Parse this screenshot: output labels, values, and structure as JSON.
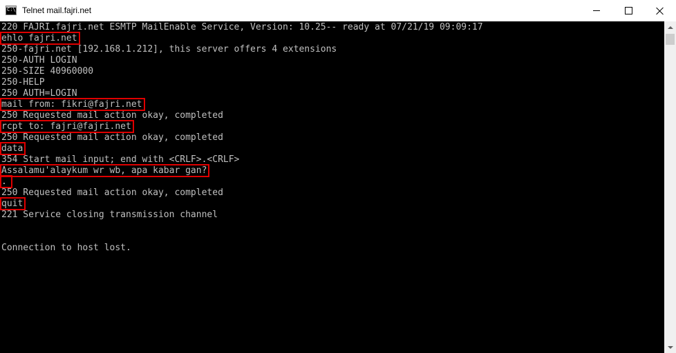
{
  "window": {
    "title": "Telnet mail.fajri.net",
    "icon": "cmd-icon",
    "icon_text": "C:\\_"
  },
  "colors": {
    "console_bg": "#000000",
    "console_text": "#c0c0c0",
    "highlight_box": "#e00000"
  },
  "console": {
    "lines": [
      "220 FAJRI.fajri.net ESMTP MailEnable Service, Version: 10.25-- ready at 07/21/19 09:09:17",
      "ehlo fajri.net",
      "250-fajri.net [192.168.1.212], this server offers 4 extensions",
      "250-AUTH LOGIN",
      "250-SIZE 40960000",
      "250-HELP",
      "250 AUTH=LOGIN",
      "mail from: fikri@fajri.net",
      "250 Requested mail action okay, completed",
      "rcpt to: fajri@fajri.net",
      "250 Requested mail action okay, completed",
      "data",
      "354 Start mail input; end with <CRLF>.<CRLF>",
      "Assalamu'alaykum wr wb, apa kabar gan?",
      ".",
      "250 Requested mail action okay, completed",
      "quit",
      "221 Service closing transmission channel",
      "",
      "",
      "Connection to host lost."
    ],
    "highlighted_commands": [
      "ehlo fajri.net",
      "mail from: fikri@fajri.net",
      "rcpt to: fajri@fajri.net",
      "data",
      "Assalamu'alaykum wr wb, apa kabar gan?",
      ".",
      "quit"
    ]
  }
}
